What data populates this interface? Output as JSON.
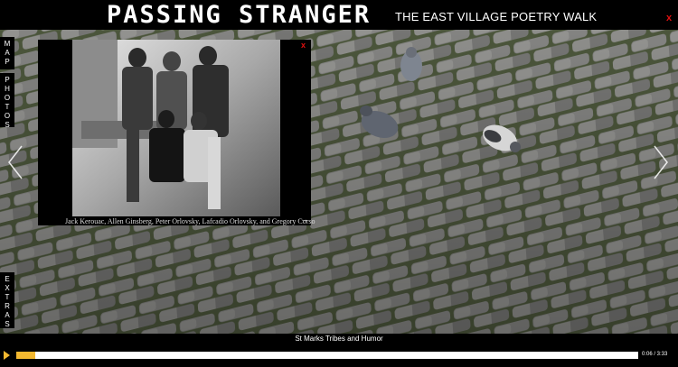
{
  "header": {
    "logo_text": "PASSING STRANGER",
    "subtitle": "THE EAST VILLAGE POETRY WALK",
    "close_label": "x"
  },
  "side_tabs": {
    "map": "MAP",
    "photos": "PHOTOS",
    "extras": "EXTRAS"
  },
  "navigation": {
    "prev_icon": "chevron-left-icon",
    "next_icon": "chevron-right-icon"
  },
  "photo_popup": {
    "close_label": "x",
    "caption": "Jack Kerouac, Allen Ginsberg, Peter Orlovsky, Lafcadio Orlovsky, and Gregory Corso",
    "caption_arrow": "→"
  },
  "player": {
    "track_title": "St Marks Tribes and Humor",
    "time": "0:06 / 3:33",
    "progress": 0.03,
    "accent_color": "#f3b830"
  }
}
